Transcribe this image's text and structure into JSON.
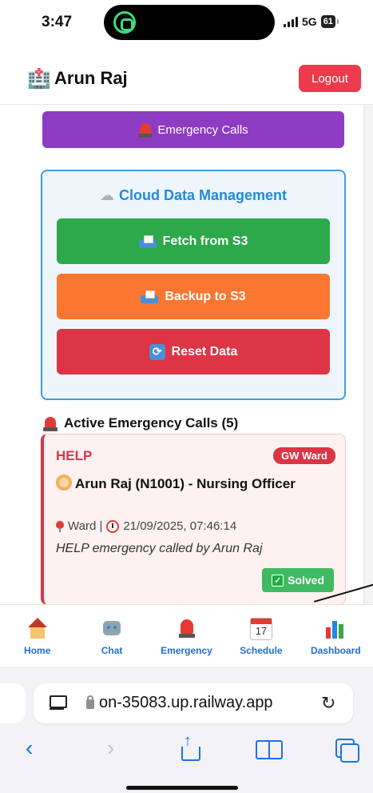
{
  "status_bar": {
    "time": "3:47",
    "network": "5G",
    "battery": "61"
  },
  "header": {
    "user_name": "Arun Raj",
    "logout_label": "Logout"
  },
  "emergency_button": {
    "label": "Emergency Calls"
  },
  "cloud": {
    "title": "Cloud Data Management",
    "fetch_label": "Fetch from S3",
    "backup_label": "Backup to S3",
    "reset_label": "Reset Data"
  },
  "active_calls": {
    "title": "Active Emergency Calls (5)",
    "calls": [
      {
        "type": "HELP",
        "ward_badge": "GW Ward",
        "person": "Arun Raj (N1001) - Nursing Officer",
        "location": "Ward |",
        "datetime": "21/09/2025, 07:46:14",
        "description": "HELP emergency called by Arun Raj",
        "status_label": "Solved"
      }
    ]
  },
  "bottom_nav": {
    "items": [
      {
        "label": "Home",
        "icon": "house-icon"
      },
      {
        "label": "Chat",
        "icon": "robot-icon"
      },
      {
        "label": "Emergency",
        "icon": "siren-icon"
      },
      {
        "label": "Schedule",
        "icon": "calendar-icon",
        "day": "17"
      },
      {
        "label": "Dashboard",
        "icon": "bar-chart-icon"
      }
    ]
  },
  "browser": {
    "url": "on-35083.up.railway.app"
  },
  "colors": {
    "accent_purple": "#8e3bc3",
    "fetch_green": "#2da84a",
    "backup_orange": "#fb7731",
    "reset_red": "#dc3545",
    "nav_blue": "#1f6fd1"
  }
}
